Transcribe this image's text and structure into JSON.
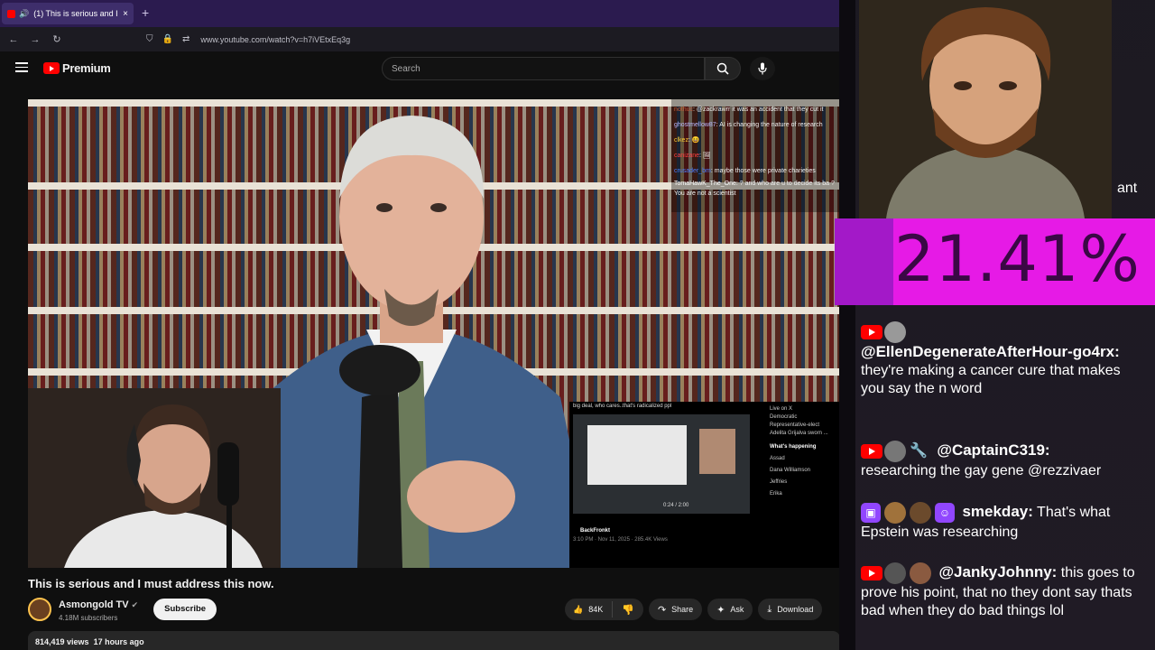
{
  "browser": {
    "tab_title": "(1) This is serious and I must",
    "tab_close": "×",
    "new_tab": "+",
    "url": "www.youtube.com/watch?v=h7iVEtxEq3g"
  },
  "youtube": {
    "logo_text": "Premium",
    "search_placeholder": "Search"
  },
  "video": {
    "chat_overlay": [
      {
        "user": "nothuc",
        "text": "@zackrawrr it was an accident that they cut it"
      },
      {
        "user": "ghostmellow87",
        "text": "AI is changing the nature of research"
      },
      {
        "user": "clkez",
        "text": "😆"
      },
      {
        "user": "canizane",
        "text": "🖼"
      },
      {
        "user": "crusader_bm",
        "text": "maybe those were private charieties"
      },
      {
        "user": "TomaHawK_The_One",
        "text": "? and who are u to decide its ba ? You are not a scientist"
      }
    ],
    "tweet_caption": "big deal, who cares..that's radicalized ppl",
    "tweet_author": "BackFronkt",
    "tweet_meta": "3:10 PM · Nov 11, 2025 · 285.4K Views",
    "tweet_time": "0:24 / 2:00",
    "tweet_side": [
      "Live on X",
      "Democratic Representative-elect Adelita Grijalva sworn ...",
      "What's happening",
      "Assad",
      "Dana Williamson",
      "Jeffries",
      "Erika"
    ]
  },
  "meta": {
    "title": "This is serious and I must address this now.",
    "channel_name": "Asmongold TV",
    "verified": "✔",
    "subscribers": "4.18M subscribers",
    "subscribe_label": "Subscribe",
    "likes": "84K",
    "share_label": "Share",
    "ask_label": "Ask",
    "download_label": "Download",
    "views": "814,419 views",
    "uploaded": "17 hours ago"
  },
  "stream": {
    "cartoon_text": "ant",
    "meter_value": "21.41%",
    "chat": [
      {
        "user": "@EllenDegenerateAfterHour-go4rx:",
        "text": "they're making a cancer cure that makes you say the n word"
      },
      {
        "user": "@CaptainC319:",
        "text": "researching the gay gene @rezzivaer"
      },
      {
        "user": "smekday:",
        "text": "That's what Epstein was researching"
      },
      {
        "user": "@JankyJohnny:",
        "text": "this goes to prove his point, that no they dont say thats bad when they do bad things lol"
      }
    ]
  }
}
